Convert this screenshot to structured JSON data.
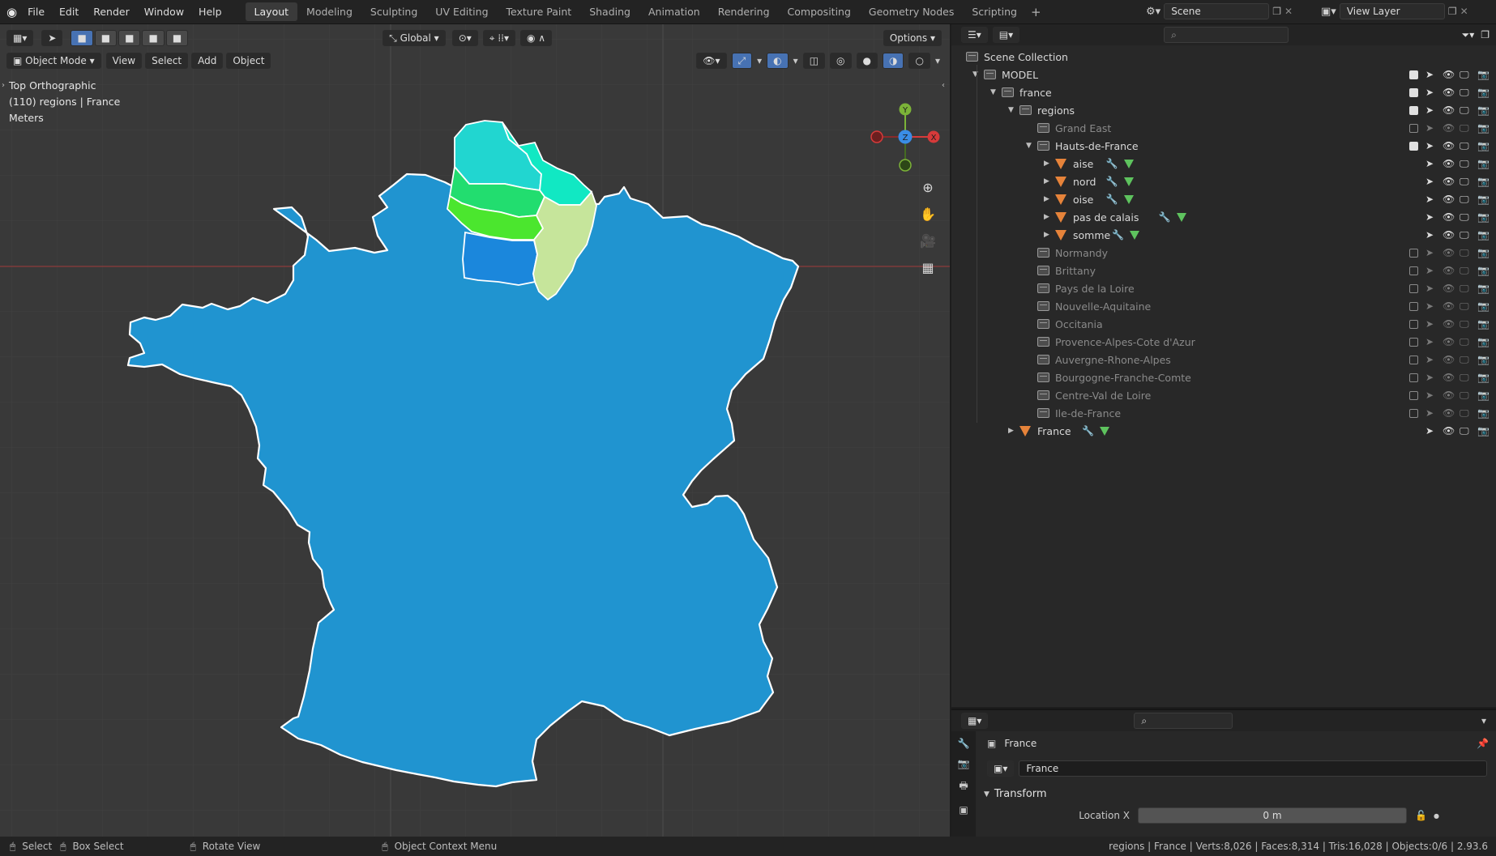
{
  "topbar": {
    "menus": [
      "File",
      "Edit",
      "Render",
      "Window",
      "Help"
    ],
    "workspaces": [
      "Layout",
      "Modeling",
      "Sculpting",
      "UV Editing",
      "Texture Paint",
      "Shading",
      "Animation",
      "Rendering",
      "Compositing",
      "Geometry Nodes",
      "Scripting"
    ],
    "active_workspace": "Layout",
    "scene": "Scene",
    "view_layer": "View Layer"
  },
  "viewport": {
    "mode": "Object Mode",
    "menus": [
      "View",
      "Select",
      "Add",
      "Object"
    ],
    "orientation": "Global",
    "options": "Options",
    "overlay_lines": [
      "Top Orthographic",
      "(110) regions | France",
      "Meters"
    ],
    "gizmo_axes": [
      "Y",
      "Z",
      "X"
    ],
    "region_colors": {
      "france": "#2094d0",
      "pas_de_calais": "#21d6d0",
      "nord": "#11e8c3",
      "somme": "#22dd6f",
      "oise": "#1b87dc",
      "aisne_upper": "#4be62e",
      "aisne": "#c6e59b"
    }
  },
  "outliner": {
    "search_placeholder": "",
    "rows": [
      {
        "label": "Scene Collection",
        "type": "scene",
        "indent": 0
      },
      {
        "label": "MODEL",
        "type": "collection",
        "indent": 1,
        "expanded": true,
        "checked": true
      },
      {
        "label": "france",
        "type": "collection",
        "indent": 2,
        "expanded": true,
        "checked": true
      },
      {
        "label": "regions",
        "type": "collection",
        "indent": 3,
        "expanded": true,
        "checked": true
      },
      {
        "label": "Grand East",
        "type": "collection",
        "indent": 4,
        "checked": false,
        "dim": true
      },
      {
        "label": "Hauts-de-France",
        "type": "collection",
        "indent": 4,
        "expanded": true,
        "checked": true
      },
      {
        "label": "aise",
        "type": "mesh",
        "indent": 5
      },
      {
        "label": "nord",
        "type": "mesh",
        "indent": 5
      },
      {
        "label": "oise",
        "type": "mesh",
        "indent": 5
      },
      {
        "label": "pas de calais",
        "type": "mesh",
        "indent": 5
      },
      {
        "label": "somme",
        "type": "mesh",
        "indent": 5
      },
      {
        "label": "Normandy",
        "type": "collection",
        "indent": 4,
        "checked": false,
        "dim": true
      },
      {
        "label": "Brittany",
        "type": "collection",
        "indent": 4,
        "checked": false,
        "dim": true
      },
      {
        "label": "Pays de la Loire",
        "type": "collection",
        "indent": 4,
        "checked": false,
        "dim": true
      },
      {
        "label": "Nouvelle-Aquitaine",
        "type": "collection",
        "indent": 4,
        "checked": false,
        "dim": true
      },
      {
        "label": "Occitania",
        "type": "collection",
        "indent": 4,
        "checked": false,
        "dim": true
      },
      {
        "label": "Provence-Alpes-Cote d'Azur",
        "type": "collection",
        "indent": 4,
        "checked": false,
        "dim": true
      },
      {
        "label": "Auvergne-Rhone-Alpes",
        "type": "collection",
        "indent": 4,
        "checked": false,
        "dim": true
      },
      {
        "label": "Bourgogne-Franche-Comte",
        "type": "collection",
        "indent": 4,
        "checked": false,
        "dim": true
      },
      {
        "label": "Centre-Val de Loire",
        "type": "collection",
        "indent": 4,
        "checked": false,
        "dim": true
      },
      {
        "label": "Ile-de-France",
        "type": "collection",
        "indent": 4,
        "checked": false,
        "dim": true
      },
      {
        "label": "France",
        "type": "mesh",
        "indent": 3,
        "collapsed": true
      }
    ]
  },
  "properties": {
    "object_name": "France",
    "data_name": "France",
    "section": "Transform",
    "location_x_label": "Location X",
    "location_x_value": "0 m"
  },
  "statusbar": {
    "select": "Select",
    "box_select": "Box Select",
    "rotate": "Rotate View",
    "context_menu": "Object Context Menu",
    "stats": "regions | France | Verts:8,026 | Faces:8,314 | Tris:16,028 | Objects:0/6 | 2.93.6"
  }
}
